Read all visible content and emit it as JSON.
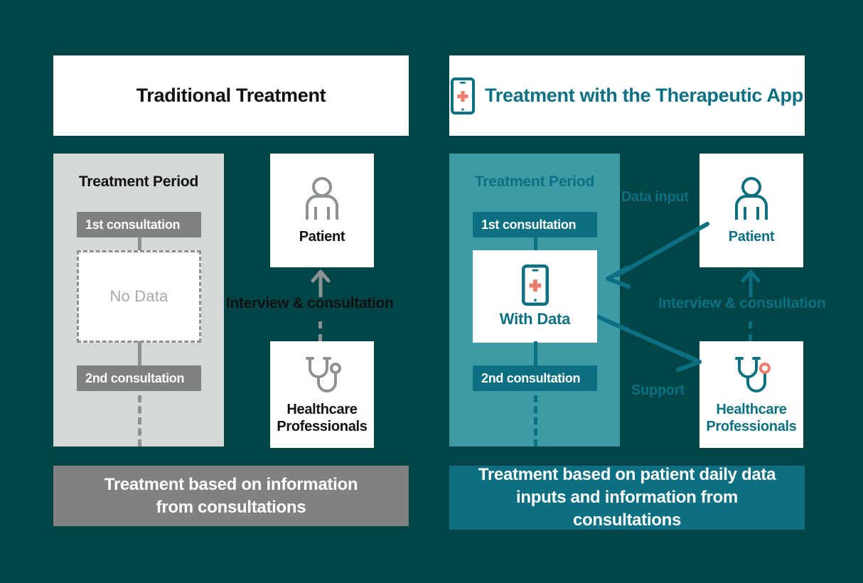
{
  "colors": {
    "background": "#014546",
    "panel_gray": "#D4D8D8",
    "panel_teal": "#3C9BA4",
    "badge_gray": "#7F8281",
    "badge_teal": "#0C7082",
    "accent_coral": "#EC7C6E",
    "icon_gray": "#8D9190",
    "white": "#FFFFFF",
    "no_data_text": "#A8AAAA"
  },
  "left_column": {
    "header": {
      "title": "Traditional Treatment"
    },
    "period": {
      "title": "Treatment Period",
      "first_consultation": "1st consultation",
      "second_consultation": "2nd consultation",
      "data_box_label": "No Data"
    },
    "patient": {
      "label": "Patient",
      "icon": "person-icon"
    },
    "healthcare": {
      "label": "Healthcare\nProfessionals",
      "line1": "Healthcare",
      "line2": "Professionals",
      "icon": "stethoscope-icon"
    },
    "flow": {
      "interview_label": "Interview & consultation"
    },
    "banner": {
      "line1": "Treatment based on information",
      "line2": "from consultations"
    }
  },
  "right_column": {
    "header": {
      "title": "Treatment with the Therapeutic App",
      "icon": "smartphone-medical-icon"
    },
    "period": {
      "title": "Treatment Period",
      "first_consultation": "1st consultation",
      "second_consultation": "2nd consultation",
      "data_box_label": "With Data",
      "data_box_icon": "smartphone-medical-icon"
    },
    "patient": {
      "label": "Patient",
      "icon": "person-icon"
    },
    "healthcare": {
      "line1": "Healthcare",
      "line2": "Professionals",
      "icon": "stethoscope-icon"
    },
    "flow": {
      "interview_label": "Interview & consultation",
      "data_input_label": "Data input",
      "support_label": "Support"
    },
    "banner": {
      "line1": "Treatment based on patient daily data",
      "line2": "inputs and information from consultations"
    }
  }
}
